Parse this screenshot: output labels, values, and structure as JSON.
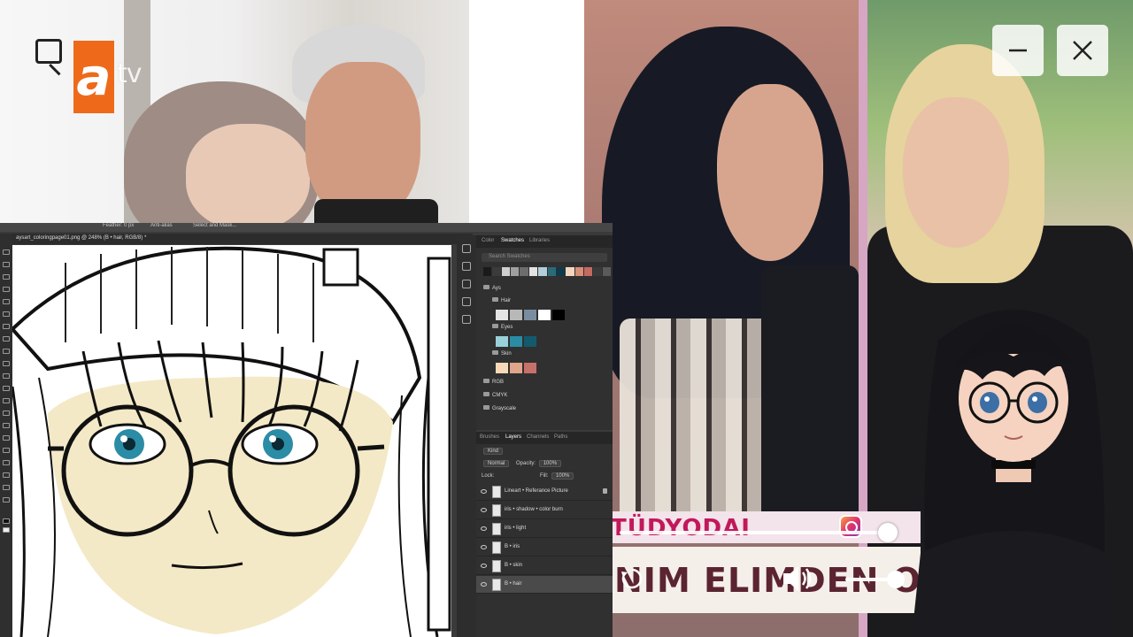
{
  "tv": {
    "channel_logo_a": "a",
    "channel_logo_tv": "tv"
  },
  "window_controls": {
    "minimize_icon": "minimize-icon",
    "close_icon": "close-icon"
  },
  "lower_third": {
    "top_strip": "TÜDYODAI",
    "main_text": "NIM ELIMDEN OLMAS"
  },
  "player": {
    "seek_progress": 0.97,
    "volume_level": 0.72
  },
  "photoshop": {
    "document_tab": "aysart_coloringpage01.png @ 248% (B • hair, RGB/8) *",
    "options_bar": [
      "Feather: 0 px",
      "Anti-alias",
      "Select and Mask..."
    ],
    "panel_tabs_top": [
      "Color",
      "Swatches",
      "Libraries"
    ],
    "active_top_tab": "Swatches",
    "search_placeholder": "Search Swatches",
    "swatch_groups": [
      {
        "name": "Ays",
        "level": 0
      },
      {
        "name": "Hair",
        "level": 1
      },
      {
        "name": "Eyes",
        "level": 1
      },
      {
        "name": "Skin",
        "level": 1
      },
      {
        "name": "RGB",
        "level": 0
      },
      {
        "name": "CMYK",
        "level": 0
      },
      {
        "name": "Grayscale",
        "level": 0
      }
    ],
    "recent_swatches": [
      "#1a1a1a",
      "#3b3b3b",
      "#cfcfcf",
      "#a0a0a0",
      "#6d6d6d",
      "#e3e3e3",
      "#b2ced9",
      "#2a6a7a",
      "#0e3b4a",
      "#f2d6bf",
      "#d88e78",
      "#c46a60",
      "#3a3a3a",
      "#5a5a5a"
    ],
    "hair_swatches": [
      "#e4e4e4",
      "#b8b8b8",
      "#7a8da0",
      "#ffffff",
      "#000000"
    ],
    "eyes_swatches": [
      "#9ad1d9",
      "#2b8ca6",
      "#145a6e"
    ],
    "skin_swatches": [
      "#f7d9b9",
      "#e0a58a",
      "#c7716a"
    ],
    "layer_tabs": [
      "Brushes",
      "Layers",
      "Channels",
      "Paths"
    ],
    "active_layer_tab": "Layers",
    "kind_label": "Kind",
    "blend_mode": "Normal",
    "opacity_label": "Opacity:",
    "opacity_value": "100%",
    "lock_label": "Lock:",
    "fill_label": "Fill:",
    "fill_value": "100%",
    "layers": [
      {
        "name": "Lineart • Referance Picture",
        "locked": true,
        "selected": false
      },
      {
        "name": "iris • shadow • color burn",
        "locked": false,
        "selected": false
      },
      {
        "name": "iris • light",
        "locked": false,
        "selected": false
      },
      {
        "name": "B • iris",
        "locked": false,
        "selected": false
      },
      {
        "name": "B • skin",
        "locked": false,
        "selected": false
      },
      {
        "name": "B • hair",
        "locked": false,
        "selected": true
      }
    ]
  },
  "colors": {
    "atv_orange": "#ee6a1a",
    "lower_third_pink": "#c2185b",
    "lower_third_maroon": "#5b2431",
    "eye_blue": "#2b8ca6"
  }
}
